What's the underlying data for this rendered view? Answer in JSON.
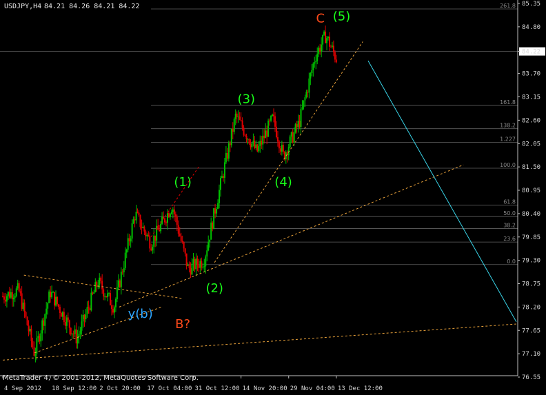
{
  "header": {
    "symbol": "USDJPY,H4",
    "ohlc": "84.21 84.26 84.21 84.22"
  },
  "footer": {
    "copyright": "MetaTrader 4, © 2001-2012, MetaQuotes Software Corp."
  },
  "colors": {
    "background": "#000000",
    "grid": "#333333",
    "candle_up": "#00c000",
    "candle_down": "#e00000",
    "wave_label": "#19ff19",
    "abc_label": "#ff4a1a",
    "y_label": "#2ea6ff",
    "trendline": "#e8a13a",
    "projection": "#39d4e8",
    "fib": "#606060"
  },
  "chart_data": {
    "type": "candlestick",
    "symbol": "USDJPY",
    "timeframe": "H4",
    "ylim": [
      76.55,
      85.35
    ],
    "y_ticks": [
      "85.35",
      "84.80",
      "84.22",
      "83.70",
      "83.15",
      "82.60",
      "82.05",
      "81.50",
      "80.95",
      "80.40",
      "79.85",
      "79.30",
      "78.75",
      "78.20",
      "77.65",
      "77.10",
      "76.55"
    ],
    "x_ticks": [
      "4 Sep 2012",
      "18 Sep 12:00",
      "2 Oct 20:00",
      "17 Oct 04:00",
      "31 Oct 12:00",
      "14 Nov 20:00",
      "29 Nov 04:00",
      "13 Dec 12:00"
    ],
    "current_price": "84.22",
    "approx_price_path": [
      {
        "t": 0,
        "price": 78.45
      },
      {
        "t": 3,
        "price": 78.6
      },
      {
        "t": 6,
        "price": 77.1
      },
      {
        "t": 9,
        "price": 78.55
      },
      {
        "t": 14,
        "price": 77.45
      },
      {
        "t": 18,
        "price": 78.8
      },
      {
        "t": 21,
        "price": 78.2
      },
      {
        "t": 25,
        "price": 80.4
      },
      {
        "t": 28,
        "price": 79.7
      },
      {
        "t": 32,
        "price": 80.6
      },
      {
        "t": 35,
        "price": 79.1
      },
      {
        "t": 38,
        "price": 79.3
      },
      {
        "t": 41,
        "price": 81.0
      },
      {
        "t": 44,
        "price": 82.7
      },
      {
        "t": 48,
        "price": 81.85
      },
      {
        "t": 51,
        "price": 82.65
      },
      {
        "t": 53,
        "price": 81.75
      },
      {
        "t": 56,
        "price": 82.55
      },
      {
        "t": 59,
        "price": 84.1
      },
      {
        "t": 61,
        "price": 84.6
      },
      {
        "t": 63,
        "price": 84.05
      }
    ],
    "fibonacci_levels": [
      {
        "label": "261.8",
        "price": 85.22
      },
      {
        "label": "161.8",
        "price": 82.95
      },
      {
        "label": "138.2",
        "price": 82.4
      },
      {
        "label": "1.227",
        "price": 82.08
      },
      {
        "label": "100.0",
        "price": 81.47
      },
      {
        "label": "61.8",
        "price": 80.6
      },
      {
        "label": "50.0",
        "price": 80.33
      },
      {
        "label": "38.2",
        "price": 80.05
      },
      {
        "label": "23.6",
        "price": 79.73
      },
      {
        "label": "0.0",
        "price": 79.2
      }
    ],
    "wave_labels": [
      {
        "text": "(1)",
        "color_key": "wave_label",
        "t": 34,
        "price": 81.05
      },
      {
        "text": "(2)",
        "color_key": "wave_label",
        "t": 40,
        "price": 78.55
      },
      {
        "text": "(3)",
        "color_key": "wave_label",
        "t": 46,
        "price": 83.0
      },
      {
        "text": "(4)",
        "color_key": "wave_label",
        "t": 53,
        "price": 81.05
      },
      {
        "text": "(5)",
        "color_key": "wave_label",
        "t": 64,
        "price": 84.95
      },
      {
        "text": "C",
        "color_key": "abc_label",
        "t": 60,
        "price": 84.9
      },
      {
        "text": "y(b)",
        "color_key": "y_label",
        "t": 26,
        "price": 77.95
      },
      {
        "text": "B?",
        "color_key": "abc_label",
        "t": 34,
        "price": 77.7
      }
    ],
    "lines": [
      {
        "name": "lower-trendline",
        "style": "dashed",
        "color_key": "trendline",
        "p1": {
          "t": 0,
          "price": 76.95
        },
        "p2": {
          "t": 97,
          "price": 77.8
        }
      },
      {
        "name": "channel-upper-trendline",
        "style": "dashed",
        "color_key": "trendline",
        "p1": {
          "t": 4,
          "price": 78.95
        },
        "p2": {
          "t": 34,
          "price": 78.4
        }
      },
      {
        "name": "channel-lower-trendline",
        "style": "dashed",
        "color_key": "trendline",
        "p1": {
          "t": 6,
          "price": 77.12
        },
        "p2": {
          "t": 30,
          "price": 78.2
        }
      },
      {
        "name": "wave1-trendline",
        "style": "dashed",
        "color_key": "candle_down",
        "p1": {
          "t": 28,
          "price": 79.85
        },
        "p2": {
          "t": 37,
          "price": 81.5
        }
      },
      {
        "name": "mid-trendline",
        "style": "dashed",
        "color_key": "trendline",
        "p1": {
          "t": 22,
          "price": 78.2
        },
        "p2": {
          "t": 87,
          "price": 81.55
        }
      },
      {
        "name": "impulse-trendline",
        "style": "dashed",
        "color_key": "trendline",
        "p1": {
          "t": 40,
          "price": 79.25
        },
        "p2": {
          "t": 68,
          "price": 84.45
        }
      },
      {
        "name": "projection-line",
        "style": "solid",
        "color_key": "projection",
        "p1": {
          "t": 69,
          "price": 84.0
        },
        "p2": {
          "t": 97,
          "price": 77.85
        }
      }
    ]
  }
}
